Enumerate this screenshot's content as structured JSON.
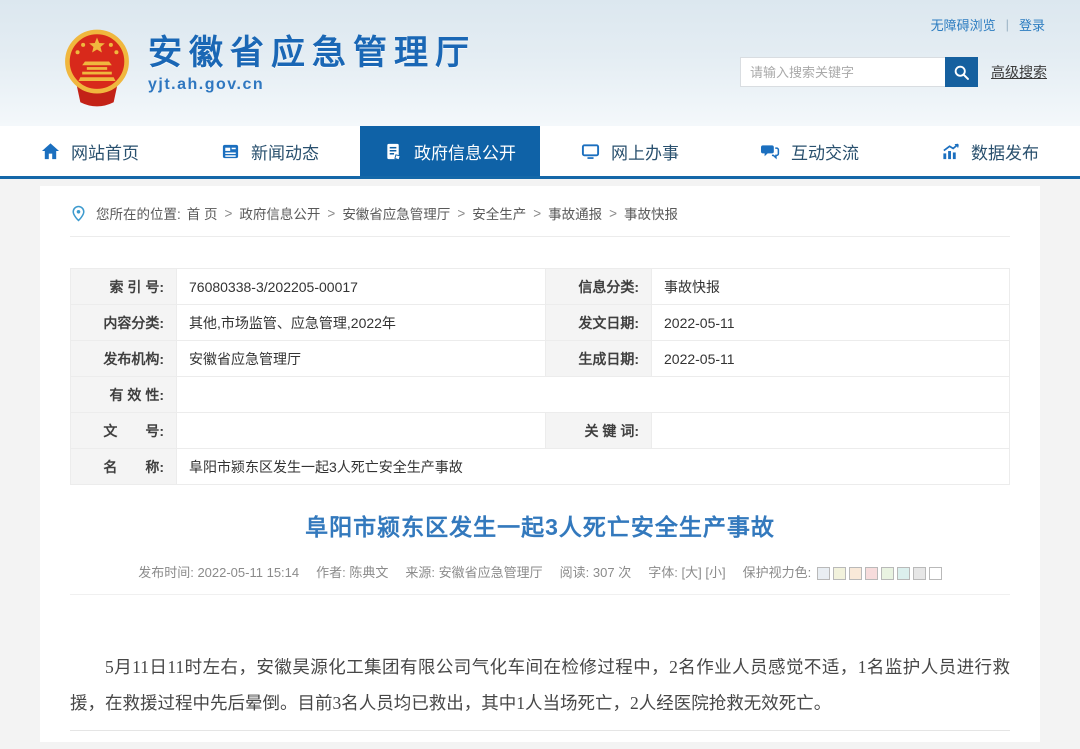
{
  "top_bar": {
    "accessibility_label": "无障碍浏览",
    "separator": "|",
    "login_label": "登录"
  },
  "header": {
    "site_name": "安徽省应急管理厅",
    "site_domain": "yjt.ah.gov.cn",
    "search": {
      "placeholder": "请输入搜索关键字",
      "advanced_label": "高级搜索"
    }
  },
  "nav": {
    "items": [
      {
        "label": "网站首页"
      },
      {
        "label": "新闻动态"
      },
      {
        "label": "政府信息公开"
      },
      {
        "label": "网上办事"
      },
      {
        "label": "互动交流"
      },
      {
        "label": "数据发布"
      }
    ],
    "active_index": 2,
    "active_bg": "#0f62a7"
  },
  "breadcrumb": {
    "prefix": "您所在的位置:",
    "separator": ">",
    "items": [
      "首 页",
      "政府信息公开",
      "安徽省应急管理厅",
      "安全生产",
      "事故通报",
      "事故快报"
    ]
  },
  "info_table": {
    "rows": [
      {
        "l1": "索 引 号:",
        "v1": "76080338-3/202205-00017",
        "l2": "信息分类:",
        "v2": "事故快报"
      },
      {
        "l1": "内容分类:",
        "v1": "其他,市场监管、应急管理,2022年",
        "l2": "发文日期:",
        "v2": "2022-05-11"
      },
      {
        "l1": "发布机构:",
        "v1": "安徽省应急管理厅",
        "l2": "生成日期:",
        "v2": "2022-05-11"
      },
      {
        "l1": "有 效 性:",
        "v1": ""
      },
      {
        "l1": "文　　号:",
        "v1": "",
        "l2": "关 键 词:",
        "v2": ""
      },
      {
        "l1": "名　　称:",
        "v1": "阜阳市颍东区发生一起3人死亡安全生产事故"
      }
    ]
  },
  "article": {
    "title": "阜阳市颍东区发生一起3人死亡安全生产事故",
    "meta": {
      "publish_label": "发布时间:",
      "publish_value": "2022-05-11 15:14",
      "author_label": "作者:",
      "author_value": "陈典文",
      "source_label": "来源:",
      "source_value": "安徽省应急管理厅",
      "views_label": "阅读:",
      "views_value": "307 次",
      "font_label": "字体:",
      "font_large": "[大]",
      "font_small": "[小]",
      "eye_protect_label": "保护视力色:",
      "eye_colors": [
        "#e9eef3",
        "#f2f2dc",
        "#f9e9d9",
        "#f7dcdc",
        "#e9f3e1",
        "#dcf0ee",
        "#e6e6e6",
        "#ffffff"
      ]
    },
    "body": "5月11日11时左右，安徽昊源化工集团有限公司气化车间在检修过程中，2名作业人员感觉不适，1名监护人员进行救援，在救援过程中先后晕倒。目前3名人员均已救出，其中1人当场死亡，2人经医院抢救无效死亡。"
  },
  "colors": {
    "brand_blue": "#1a67b5",
    "nav_active_blue": "#0f62a7",
    "nav_underline": "#1467a8",
    "title_blue": "#3379bd",
    "emblem_red": "#d8291b",
    "emblem_gold": "#f0b73e"
  }
}
